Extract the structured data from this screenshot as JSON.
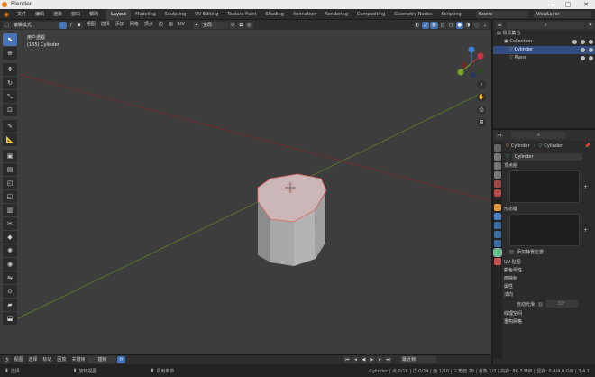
{
  "window": {
    "title": "Blender"
  },
  "menu": [
    "文件",
    "编辑",
    "渲染",
    "窗口",
    "帮助"
  ],
  "workspaces": [
    "Layout",
    "Modeling",
    "Sculpting",
    "UV Editing",
    "Texture Paint",
    "Shading",
    "Animation",
    "Rendering",
    "Compositing",
    "Geometry Nodes",
    "Scripting"
  ],
  "active_workspace": "Layout",
  "scene": "Scene",
  "view_layer": "ViewLayer",
  "viewport_header": {
    "mode": "编辑模式",
    "menus": [
      "视图",
      "选择",
      "添加",
      "网格",
      "顶点",
      "边",
      "面",
      "UV"
    ],
    "orientation": "全局"
  },
  "overlay": {
    "view_name": "用户透视",
    "object": "(155) Cylinder"
  },
  "viewport_footer": {
    "items": [
      "视图",
      "选择",
      "标记",
      "回放",
      "关键帧"
    ],
    "autokey_label": "插帧",
    "frame_mode": "最近帧"
  },
  "status": {
    "left": "选择",
    "pan": "旋转视图",
    "right_menu": "调用菜单",
    "info": "Cylinder | 点 0/16 | 边 0/24 | 面 1/10 | 三角面 28 | 对象 1/3 | 内存: 86.7 MiB | 显存: 0.4/4.0 GiB | 3.4.1"
  },
  "outliner": {
    "header": "场景集合",
    "items": [
      {
        "name": "Collection",
        "selected": false,
        "indent": 1
      },
      {
        "name": "Cylinder",
        "selected": true,
        "indent": 2
      },
      {
        "name": "Plane",
        "selected": false,
        "indent": 2
      }
    ]
  },
  "properties": {
    "breadcrumb_object": "Cylinder",
    "breadcrumb_data": "Cylinder",
    "data_name": "Cylinder",
    "sections": {
      "vertex_groups": "顶点组",
      "shape_keys": "形态键",
      "relative_label": "添加静置位置",
      "uv_maps": "UV 贴图",
      "vertex_colors": "颜色属性",
      "face_maps": "面映射",
      "attributes": "属性",
      "normals": "法向",
      "auto_smooth": "自动光滑",
      "auto_smooth_value": "30°",
      "texture_space": "纹理空间",
      "remesh": "重构网格"
    }
  },
  "colors": {
    "accent": "#4772b3",
    "x_axis": "#cc3344",
    "y_axis": "#7fa62b",
    "z_axis": "#3d7fd9",
    "active_object_outline": "#e06666"
  }
}
